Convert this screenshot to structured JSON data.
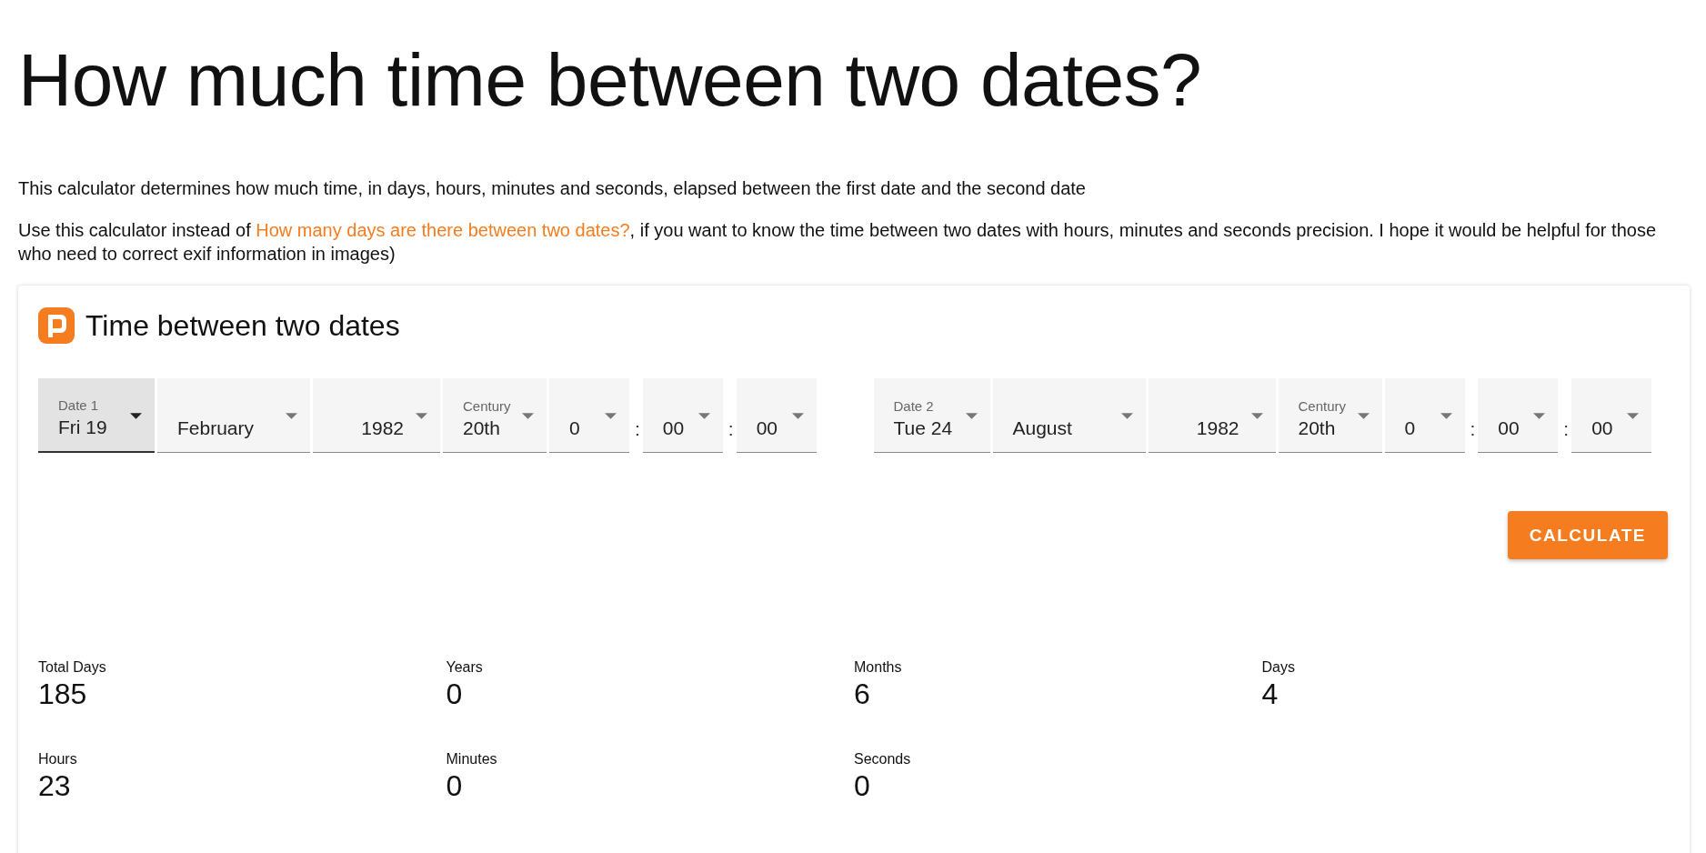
{
  "heading": "How much time between two dates?",
  "intro": "This calculator determines how much time, in days, hours, minutes and seconds, elapsed between the first date and the second date",
  "note": {
    "before": "Use this calculator instead of ",
    "link": "How many days are there between two dates?",
    "after": ", if you want to know the time between two dates with hours, minutes and seconds precision. I hope it would be helpful for those who need to correct exif information in images)"
  },
  "card": {
    "title": "Time between two dates",
    "date_groups": [
      {
        "fields": [
          {
            "kind": "day",
            "label": "Date 1",
            "value": "Fri 19",
            "focused": true
          },
          {
            "kind": "month",
            "value": "February",
            "focused": false
          },
          {
            "kind": "year",
            "value": "1982",
            "focused": false
          },
          {
            "kind": "century",
            "label": "Century",
            "value": "20th",
            "focused": false
          },
          {
            "kind": "time",
            "value": "0",
            "focused": false
          },
          {
            "kind": "time",
            "separator": ":",
            "value": "00",
            "focused": false
          },
          {
            "kind": "time",
            "separator": ":",
            "value": "00",
            "focused": false
          }
        ]
      },
      {
        "fields": [
          {
            "kind": "day",
            "label": "Date 2",
            "value": "Tue 24",
            "focused": false
          },
          {
            "kind": "month",
            "value": "August",
            "focused": false
          },
          {
            "kind": "year",
            "value": "1982",
            "focused": false
          },
          {
            "kind": "century",
            "label": "Century",
            "value": "20th",
            "focused": false
          },
          {
            "kind": "time",
            "value": "0",
            "focused": false
          },
          {
            "kind": "time",
            "separator": ":",
            "value": "00",
            "focused": false
          },
          {
            "kind": "time",
            "separator": ":",
            "value": "00",
            "focused": false
          }
        ]
      }
    ],
    "button": "CALCULATE",
    "results": [
      {
        "label": "Total Days",
        "value": "185"
      },
      {
        "label": "Years",
        "value": "0"
      },
      {
        "label": "Months",
        "value": "6"
      },
      {
        "label": "Days",
        "value": "4"
      },
      {
        "label": "Hours",
        "value": "23"
      },
      {
        "label": "Minutes",
        "value": "0"
      },
      {
        "label": "Seconds",
        "value": "0"
      }
    ]
  }
}
